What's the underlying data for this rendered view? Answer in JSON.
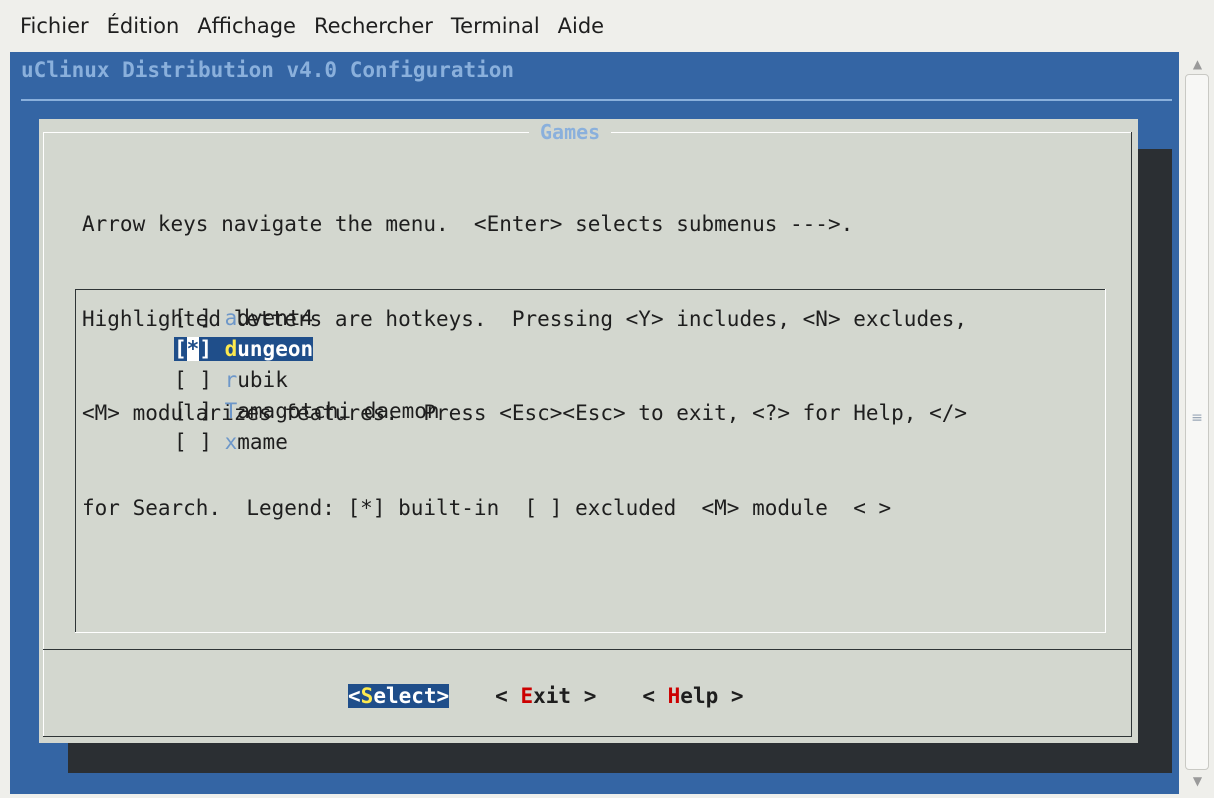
{
  "menubar": {
    "items": [
      "Fichier",
      "Édition",
      "Affichage",
      "Rechercher",
      "Terminal",
      "Aide"
    ]
  },
  "terminal": {
    "backtitle": "uClinux Distribution v4.0 Configuration",
    "dialog": {
      "title": "Games",
      "help_lines": [
        "Arrow keys navigate the menu.  <Enter> selects submenus --->.",
        "Highlighted letters are hotkeys.  Pressing <Y> includes, <N> excludes,",
        "<M> modularizes features.  Press <Esc><Esc> to exit, <?> for Help, </>",
        "for Search.  Legend: [*] built-in  [ ] excluded  <M> module  < >"
      ],
      "items": [
        {
          "mark": " ",
          "hotkey": "a",
          "rest": "dvent4",
          "selected": false
        },
        {
          "mark": "*",
          "hotkey": "d",
          "rest": "ungeon",
          "selected": true
        },
        {
          "mark": " ",
          "hotkey": "r",
          "rest": "ubik",
          "selected": false
        },
        {
          "mark": " ",
          "hotkey": "T",
          "rest": "amagotchi daemon",
          "selected": false
        },
        {
          "mark": " ",
          "hotkey": "x",
          "rest": "mame",
          "selected": false
        }
      ],
      "buttons": {
        "select": {
          "left": "<",
          "hotkey": "S",
          "right": "elect>"
        },
        "exit": {
          "left": "< ",
          "hotkey": "E",
          "right": "xit >"
        },
        "help": {
          "left": "< ",
          "hotkey": "H",
          "right": "elp >"
        }
      }
    }
  },
  "scrollbar": {
    "up_icon": "▲",
    "down_icon": "▼",
    "grip_icon": "≡"
  }
}
